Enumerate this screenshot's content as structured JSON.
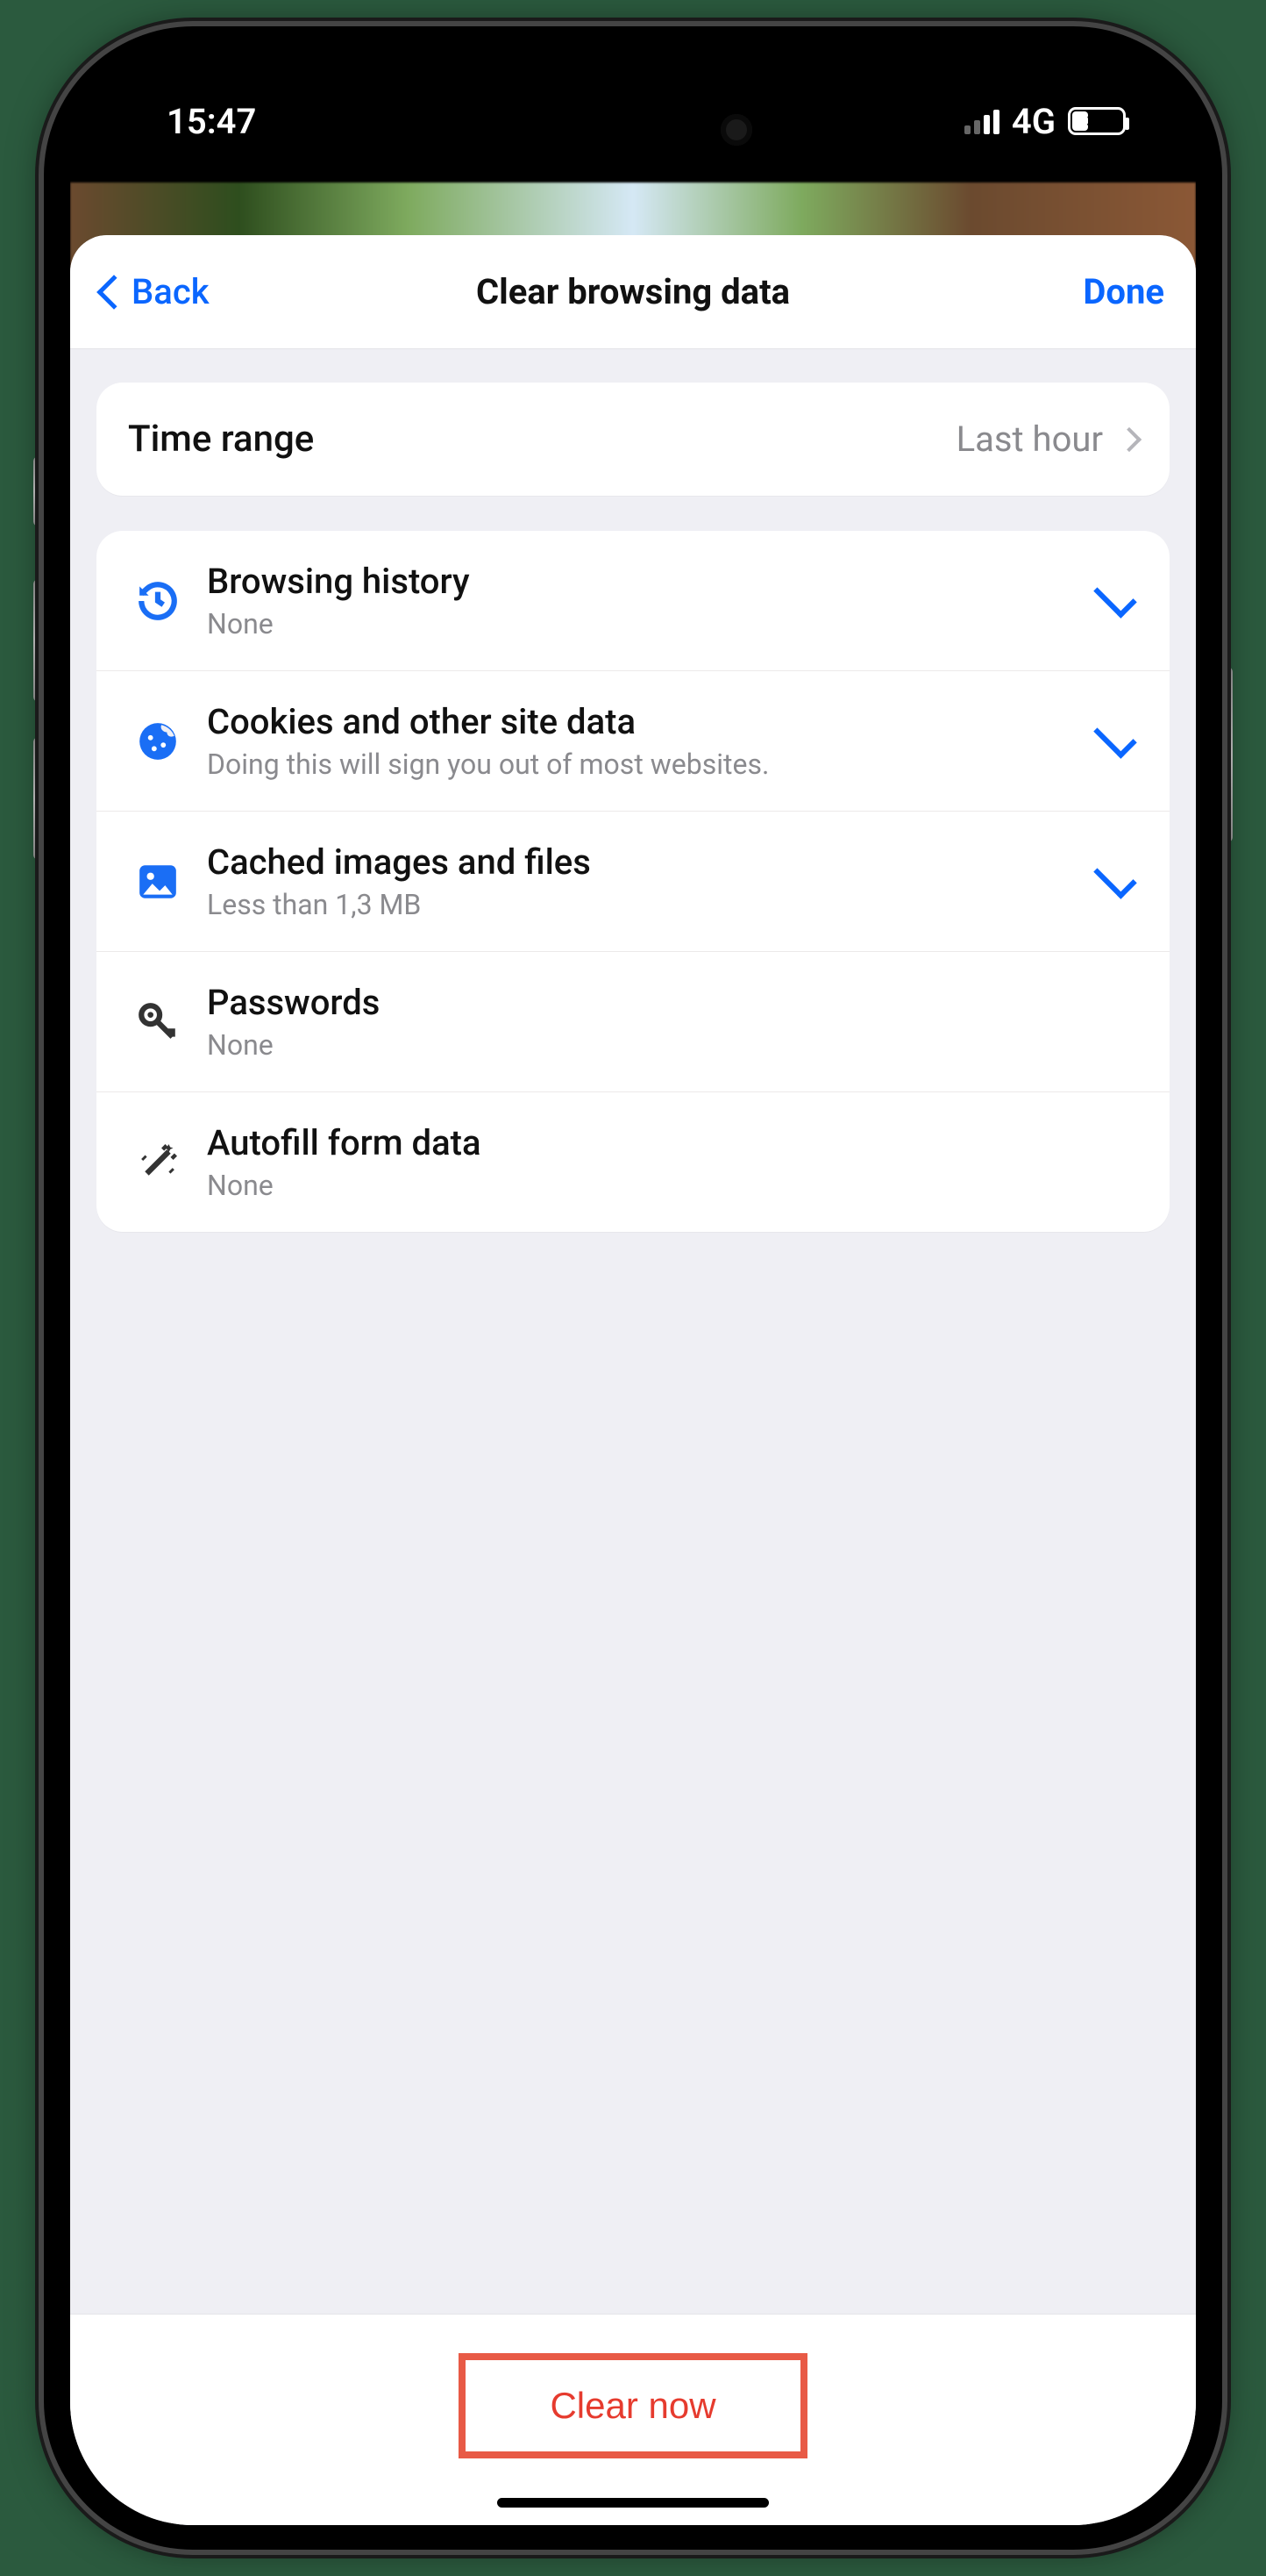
{
  "status": {
    "time": "15:47",
    "network": "4G",
    "battery_pct": "30"
  },
  "nav": {
    "back": "Back",
    "title": "Clear browsing data",
    "done": "Done"
  },
  "time_range": {
    "label": "Time range",
    "value": "Last hour"
  },
  "items": [
    {
      "title": "Browsing history",
      "sub": "None",
      "checked": true,
      "icon": "history"
    },
    {
      "title": "Cookies and other site data",
      "sub": "Doing this will sign you out of most websites.",
      "checked": true,
      "icon": "cookie"
    },
    {
      "title": "Cached images and files",
      "sub": "Less than 1,3 MB",
      "checked": true,
      "icon": "image"
    },
    {
      "title": "Passwords",
      "sub": "None",
      "checked": false,
      "icon": "key"
    },
    {
      "title": "Autofill form data",
      "sub": "None",
      "checked": false,
      "icon": "wand"
    }
  ],
  "clear_button": "Clear now"
}
